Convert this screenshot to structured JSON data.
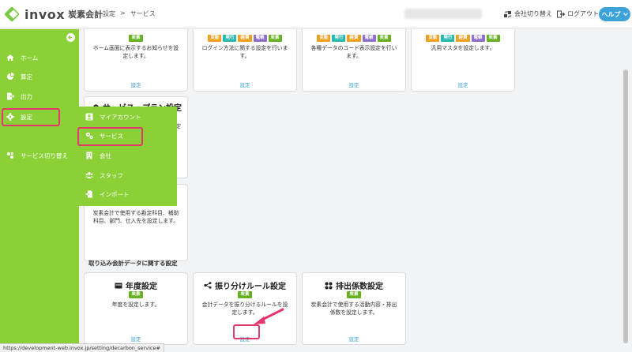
{
  "header": {
    "logo_text": "invox",
    "logo_sub": "炭素会計",
    "breadcrumb": [
      "設定",
      ">",
      "サービス"
    ],
    "switch_company": "会社切り替え",
    "logout": "ログアウト",
    "help": "ヘルプ"
  },
  "sidebar": {
    "items": [
      {
        "label": "ホーム",
        "icon": "home-icon"
      },
      {
        "label": "算定",
        "icon": "pie-chart-icon"
      },
      {
        "label": "出力",
        "icon": "export-icon"
      },
      {
        "label": "設定",
        "icon": "gear-icon"
      },
      {
        "label": "サービス切り替え",
        "icon": "switch-icon"
      }
    ]
  },
  "submenu": {
    "items": [
      {
        "label": "マイアカウント",
        "icon": "account-icon"
      },
      {
        "label": "サービス",
        "icon": "gears-icon"
      },
      {
        "label": "会社",
        "icon": "building-icon"
      },
      {
        "label": "スタッフ",
        "icon": "users-icon"
      },
      {
        "label": "インポート",
        "icon": "import-icon"
      }
    ]
  },
  "tags": {
    "tanso": "炭素",
    "hendo": "変動",
    "hakko": "発行",
    "keihi": "経費",
    "denpyo": "電帳"
  },
  "top_cards": [
    {
      "desc": "ホーム画面に表示するお知らせを設定します。",
      "link": "設定"
    },
    {
      "desc": "ログイン方法に関する設定を行います。",
      "link": "設定"
    },
    {
      "desc": "各種データのコード表示設定を行います。",
      "link": "設定"
    },
    {
      "desc": "汎用マスタを設定します。",
      "link": "設定"
    }
  ],
  "service_plan_card": {
    "title": "サービス・プラン設定",
    "desc_partial": "設定"
  },
  "account_card": {
    "desc": "炭素会計で使用する勘定科目、補助科目、部門、仕入先を設定します。"
  },
  "section_title": "取り込み会計データに関する設定",
  "bottom_cards": [
    {
      "title": "年度設定",
      "icon": "calendar-icon",
      "desc": "年度を設定します。",
      "link": "設定"
    },
    {
      "title": "振り分けルール設定",
      "icon": "share-icon",
      "desc": "会計データを振り分けるルールを設定します。",
      "link": "設定"
    },
    {
      "title": "排出係数設定",
      "icon": "grid-icon",
      "desc": "炭素会計で使用する活動内容・排出係数を設定します。",
      "link": "設定"
    }
  ],
  "status_url": "https://development-web.invox.jp/setting/decarbon_service#",
  "colors": {
    "sidebar": "#8bd037",
    "highlight": "#e2376b",
    "link": "#3ca2d8",
    "help": "#3ca2d8"
  }
}
